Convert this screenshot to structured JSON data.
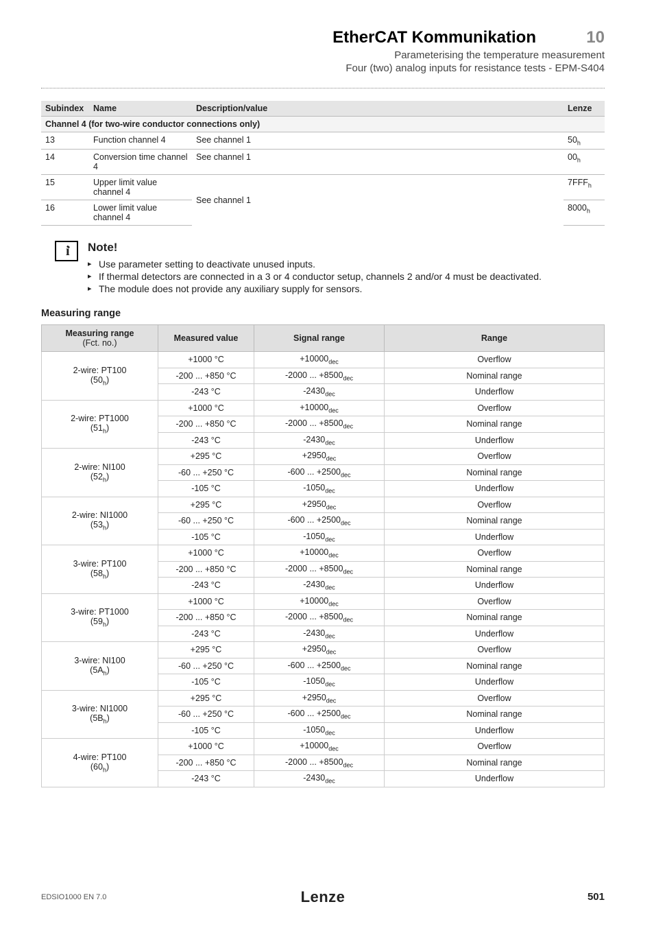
{
  "header": {
    "title": "EtherCAT Kommunikation",
    "chapter": "10",
    "subtitle1": "Parameterising the temperature measurement",
    "subtitle2": "Four (two) analog inputs for resistance tests - EPM-S404"
  },
  "table1": {
    "headers": [
      "Subindex",
      "Name",
      "Description/value",
      "Lenze"
    ],
    "section": "Channel 4 (for two-wire conductor connections only)",
    "rows": [
      {
        "sub": "13",
        "name": "Function channel 4",
        "desc": "See channel 1",
        "lenze": "50",
        "lenze_sub": "h"
      },
      {
        "sub": "14",
        "name": "Conversion time channel 4",
        "desc": "See channel 1",
        "lenze": "00",
        "lenze_sub": "h"
      },
      {
        "sub": "15",
        "name": "Upper limit value channel 4",
        "desc": "See channel 1",
        "lenze": "7FFF",
        "lenze_sub": "h",
        "rowspan_desc": 2
      },
      {
        "sub": "16",
        "name": "Lower limit value channel 4",
        "desc": "",
        "lenze": "8000",
        "lenze_sub": "h"
      }
    ]
  },
  "note": {
    "title": "Note!",
    "items": [
      "Use parameter setting to deactivate unused inputs.",
      "If thermal detectors are connected in a 3 or 4 conductor setup, channels 2 and/or 4 must be deactivated.",
      "The module does not provide any auxiliary supply for sensors."
    ]
  },
  "measuring_heading": "Measuring range",
  "table2": {
    "headers": [
      "Measuring range",
      "Measured value",
      "Signal range",
      "Range"
    ],
    "header_sub": "(Fct. no.)",
    "groups": [
      {
        "label": "2-wire: PT100",
        "fct": "50",
        "fct_sub": "h",
        "rows": [
          {
            "mv": "+1000 °C",
            "sr": "+10000",
            "sr_sub": "dec",
            "rg": "Overflow"
          },
          {
            "mv": "-200 ... +850 °C",
            "sr": "-2000 ... +8500",
            "sr_sub": "dec",
            "rg": "Nominal range"
          },
          {
            "mv": "-243 °C",
            "sr": "-2430",
            "sr_sub": "dec",
            "rg": "Underflow"
          }
        ]
      },
      {
        "label": "2-wire: PT1000",
        "fct": "51",
        "fct_sub": "h",
        "rows": [
          {
            "mv": "+1000 °C",
            "sr": "+10000",
            "sr_sub": "dec",
            "rg": "Overflow"
          },
          {
            "mv": "-200 ... +850 °C",
            "sr": "-2000 ... +8500",
            "sr_sub": "dec",
            "rg": "Nominal range"
          },
          {
            "mv": "-243 °C",
            "sr": "-2430",
            "sr_sub": "dec",
            "rg": "Underflow"
          }
        ]
      },
      {
        "label": "2-wire: NI100",
        "fct": "52",
        "fct_sub": "h",
        "rows": [
          {
            "mv": "+295 °C",
            "sr": "+2950",
            "sr_sub": "dec",
            "rg": "Overflow"
          },
          {
            "mv": "-60 ... +250 °C",
            "sr": "-600 ... +2500",
            "sr_sub": "dec",
            "rg": "Nominal range"
          },
          {
            "mv": "-105 °C",
            "sr": "-1050",
            "sr_sub": "dec",
            "rg": "Underflow"
          }
        ]
      },
      {
        "label": "2-wire: NI1000",
        "fct": "53",
        "fct_sub": "h",
        "rows": [
          {
            "mv": "+295 °C",
            "sr": "+2950",
            "sr_sub": "dec",
            "rg": "Overflow"
          },
          {
            "mv": "-60 ... +250 °C",
            "sr": "-600 ... +2500",
            "sr_sub": "dec",
            "rg": "Nominal range"
          },
          {
            "mv": "-105 °C",
            "sr": "-1050",
            "sr_sub": "dec",
            "rg": "Underflow"
          }
        ]
      },
      {
        "label": "3-wire: PT100",
        "fct": "58",
        "fct_sub": "h",
        "rows": [
          {
            "mv": "+1000 °C",
            "sr": "+10000",
            "sr_sub": "dec",
            "rg": "Overflow"
          },
          {
            "mv": "-200 ... +850 °C",
            "sr": "-2000 ... +8500",
            "sr_sub": "dec",
            "rg": "Nominal range"
          },
          {
            "mv": "-243 °C",
            "sr": "-2430",
            "sr_sub": "dec",
            "rg": "Underflow"
          }
        ]
      },
      {
        "label": "3-wire: PT1000",
        "fct": "59",
        "fct_sub": "h",
        "rows": [
          {
            "mv": "+1000 °C",
            "sr": "+10000",
            "sr_sub": "dec",
            "rg": "Overflow"
          },
          {
            "mv": "-200 ... +850 °C",
            "sr": "-2000 ... +8500",
            "sr_sub": "dec",
            "rg": "Nominal range"
          },
          {
            "mv": "-243 °C",
            "sr": "-2430",
            "sr_sub": "dec",
            "rg": "Underflow"
          }
        ]
      },
      {
        "label": "3-wire: NI100",
        "fct": "5A",
        "fct_sub": "h",
        "rows": [
          {
            "mv": "+295 °C",
            "sr": "+2950",
            "sr_sub": "dec",
            "rg": "Overflow"
          },
          {
            "mv": "-60 ... +250 °C",
            "sr": "-600 ... +2500",
            "sr_sub": "dec",
            "rg": "Nominal range"
          },
          {
            "mv": "-105 °C",
            "sr": "-1050",
            "sr_sub": "dec",
            "rg": "Underflow"
          }
        ]
      },
      {
        "label": "3-wire: NI1000",
        "fct": "5B",
        "fct_sub": "h",
        "rows": [
          {
            "mv": "+295 °C",
            "sr": "+2950",
            "sr_sub": "dec",
            "rg": "Overflow"
          },
          {
            "mv": "-60 ... +250 °C",
            "sr": "-600 ... +2500",
            "sr_sub": "dec",
            "rg": "Nominal range"
          },
          {
            "mv": "-105 °C",
            "sr": "-1050",
            "sr_sub": "dec",
            "rg": "Underflow"
          }
        ]
      },
      {
        "label": "4-wire: PT100",
        "fct": "60",
        "fct_sub": "h",
        "rows": [
          {
            "mv": "+1000 °C",
            "sr": "+10000",
            "sr_sub": "dec",
            "rg": "Overflow"
          },
          {
            "mv": "-200 ... +850 °C",
            "sr": "-2000 ... +8500",
            "sr_sub": "dec",
            "rg": "Nominal range"
          },
          {
            "mv": "-243 °C",
            "sr": "-2430",
            "sr_sub": "dec",
            "rg": "Underflow"
          }
        ]
      }
    ]
  },
  "footer": {
    "left": "EDSIO1000 EN 7.0",
    "center": "Lenze",
    "right": "501"
  }
}
